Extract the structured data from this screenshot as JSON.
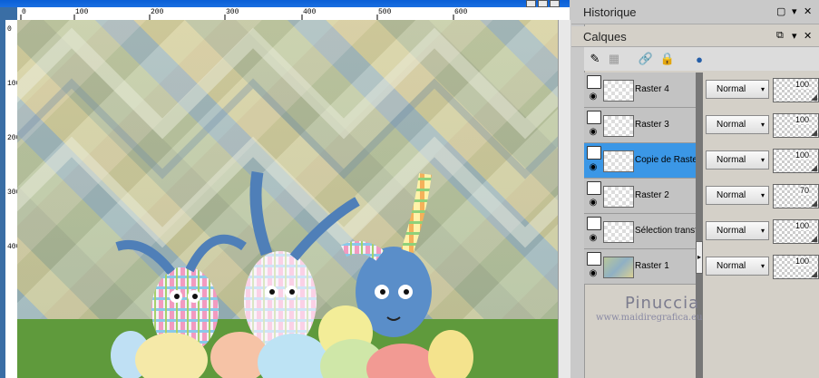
{
  "rulers": {
    "top_ticks": [
      "0",
      "100",
      "200",
      "300",
      "400",
      "500",
      "600"
    ],
    "left_ticks": [
      "0",
      "100",
      "200",
      "300",
      "400"
    ]
  },
  "panels": {
    "history": {
      "title": "Historique"
    },
    "layers": {
      "title": "Calques"
    }
  },
  "layers": [
    {
      "name": "Raster 4",
      "blend": "Normal",
      "opacity": "100",
      "selected": false
    },
    {
      "name": "Raster 3",
      "blend": "Normal",
      "opacity": "100",
      "selected": false
    },
    {
      "name": "Copie de Raster",
      "blend": "Normal",
      "opacity": "100",
      "selected": true
    },
    {
      "name": "Raster 2",
      "blend": "Normal",
      "opacity": "70",
      "selected": false
    },
    {
      "name": "Sélection transfo",
      "blend": "Normal",
      "opacity": "100",
      "selected": false
    },
    {
      "name": "Raster 1",
      "blend": "Normal",
      "opacity": "100",
      "selected": false
    }
  ],
  "watermark": {
    "name": "Pinuccia",
    "url": "www.maidiregrafica.eu"
  },
  "colors": {
    "selected": "#3b97e6",
    "titlebar": "#0a5fd6"
  }
}
